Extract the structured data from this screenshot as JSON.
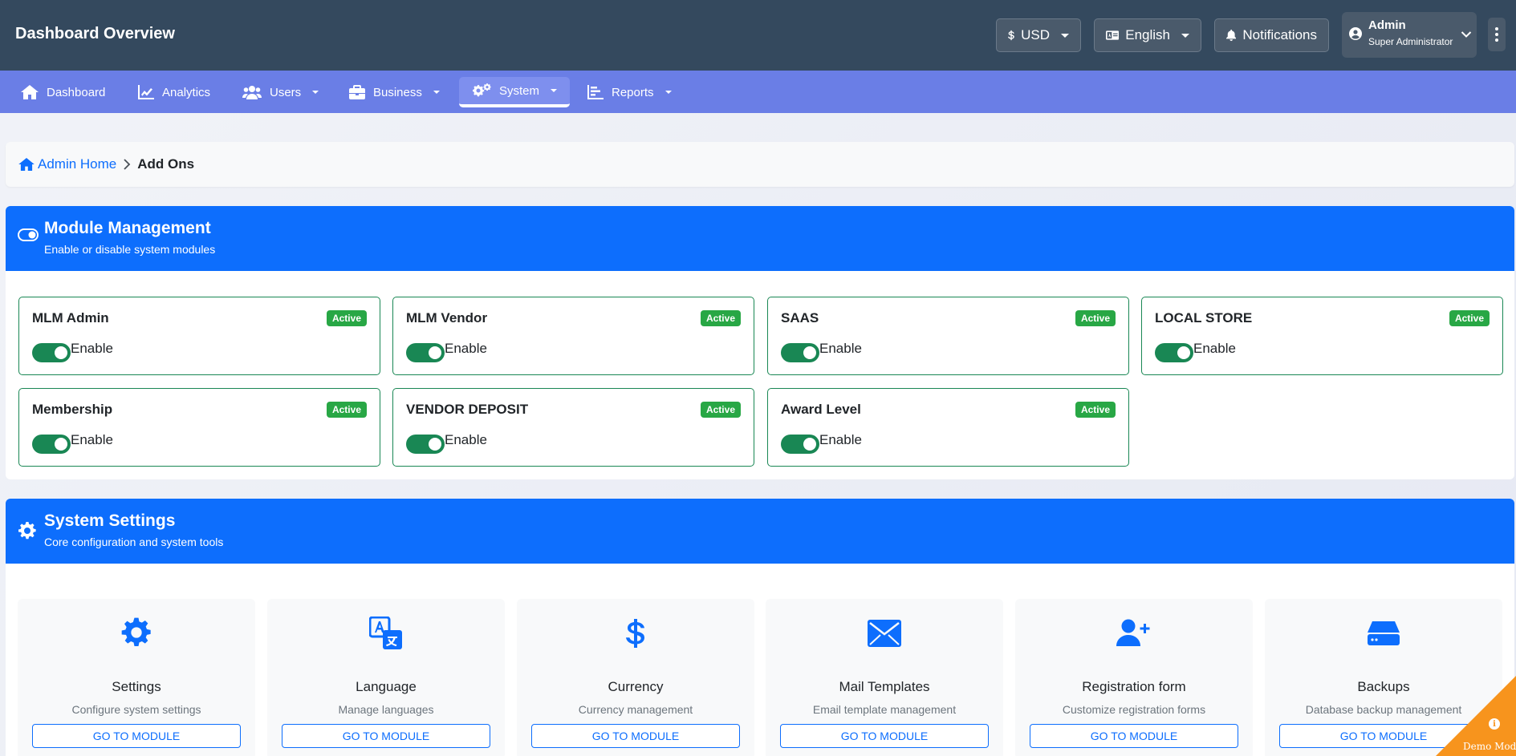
{
  "header": {
    "title": "Dashboard Overview",
    "currency": "USD",
    "language": "English",
    "notifications": "Notifications",
    "user_name": "Admin",
    "user_role": "Super Administrator"
  },
  "nav": {
    "items": [
      {
        "label": "Dashboard",
        "icon": "home-icon"
      },
      {
        "label": "Analytics",
        "icon": "line-chart-icon"
      },
      {
        "label": "Users",
        "icon": "users-icon"
      },
      {
        "label": "Business",
        "icon": "briefcase-icon"
      },
      {
        "label": "System",
        "icon": "cogs-icon"
      },
      {
        "label": "Reports",
        "icon": "bar-chart-icon"
      }
    ]
  },
  "breadcrumb": {
    "home": "Admin Home",
    "current": "Add Ons"
  },
  "modules": {
    "title": "Module Management",
    "subtitle": "Enable or disable system modules",
    "items": [
      {
        "name": "MLM Admin",
        "status": "Active",
        "toggle_label": "Enable"
      },
      {
        "name": "MLM Vendor",
        "status": "Active",
        "toggle_label": "Enable"
      },
      {
        "name": "SAAS",
        "status": "Active",
        "toggle_label": "Enable"
      },
      {
        "name": "LOCAL STORE",
        "status": "Active",
        "toggle_label": "Enable"
      },
      {
        "name": "Membership",
        "status": "Active",
        "toggle_label": "Enable"
      },
      {
        "name": "VENDOR DEPOSIT",
        "status": "Active",
        "toggle_label": "Enable"
      },
      {
        "name": "Award Level",
        "status": "Active",
        "toggle_label": "Enable"
      }
    ]
  },
  "system": {
    "title": "System Settings",
    "subtitle": "Core configuration and system tools",
    "tools": [
      {
        "title": "Settings",
        "desc": "Configure system settings",
        "button": "GO TO MODULE",
        "icon": "gear-icon"
      },
      {
        "title": "Language",
        "desc": "Manage languages",
        "button": "GO TO MODULE",
        "icon": "language-icon"
      },
      {
        "title": "Currency",
        "desc": "Currency management",
        "button": "GO TO MODULE",
        "icon": "dollar-icon"
      },
      {
        "title": "Mail Templates",
        "desc": "Email template management",
        "button": "GO TO MODULE",
        "icon": "envelope-icon"
      },
      {
        "title": "Registration form",
        "desc": "Customize registration forms",
        "button": "GO TO MODULE",
        "icon": "user-plus-icon"
      },
      {
        "title": "Backups",
        "desc": "Database backup management",
        "button": "GO TO MODULE",
        "icon": "hdd-icon"
      }
    ]
  },
  "demo": {
    "label": "Demo Mode"
  },
  "colors": {
    "topbar": "#34495e",
    "navbar": "#6a7ee6",
    "primary": "#0d6efd",
    "success": "#198754",
    "badge": "#28a745",
    "demo": "#f7941d"
  }
}
